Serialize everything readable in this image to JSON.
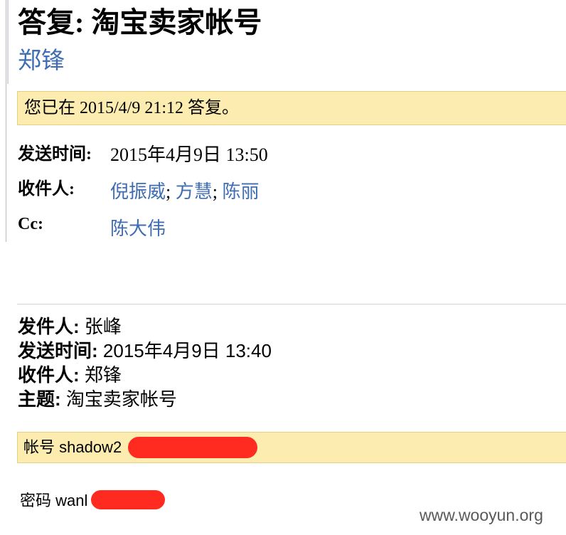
{
  "message": {
    "subject": "答复: 淘宝卖家帐号",
    "sender": "郑锋",
    "info_bar": "您已在 2015/4/9 21:12 答复。"
  },
  "headers": {
    "sent_label": "发送时间:",
    "sent_value": "2015年4月9日 13:50",
    "to_label": "收件人:",
    "to": [
      "倪振威",
      "方慧",
      "陈丽"
    ],
    "separator": ";",
    "cc_label": "Cc:",
    "cc": [
      "陈大伟"
    ]
  },
  "original": {
    "from_label": "发件人:",
    "from_value": "张峰",
    "sent_label": "发送时间:",
    "sent_value": "2015年4月9日 13:40",
    "to_label": "收件人:",
    "to_value": "郑锋",
    "subject_label": "主题:",
    "subject_value": "淘宝卖家帐号"
  },
  "body": {
    "account_text": "帐号 shadow2",
    "password_text": "密码 wanl"
  },
  "watermark": "www.wooyun.org",
  "colors": {
    "link": "#3f6db3",
    "info_bar_bg": "#fcecb0",
    "redaction": "#ff2a20"
  }
}
